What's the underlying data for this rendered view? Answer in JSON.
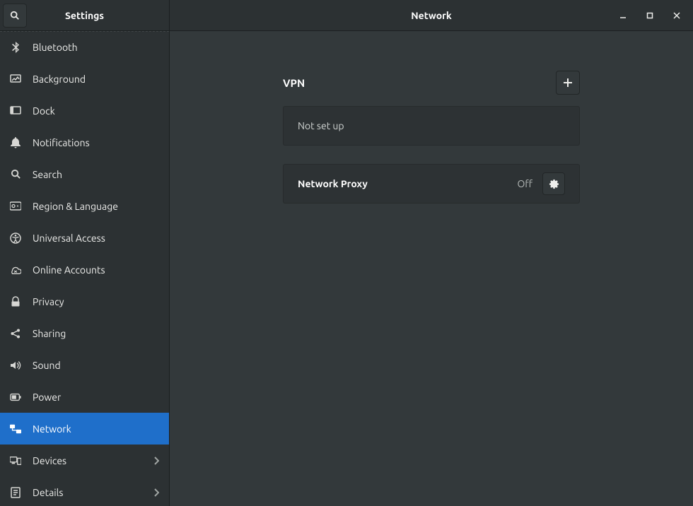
{
  "header": {
    "sidebar_title": "Settings",
    "main_title": "Network"
  },
  "sidebar": {
    "items": [
      {
        "icon": "bluetooth",
        "label": "Bluetooth",
        "active": false,
        "chevron": false
      },
      {
        "icon": "background",
        "label": "Background",
        "active": false,
        "chevron": false
      },
      {
        "icon": "dock",
        "label": "Dock",
        "active": false,
        "chevron": false
      },
      {
        "icon": "bell",
        "label": "Notifications",
        "active": false,
        "chevron": false
      },
      {
        "icon": "search",
        "label": "Search",
        "active": false,
        "chevron": false
      },
      {
        "icon": "region",
        "label": "Region & Language",
        "active": false,
        "chevron": false
      },
      {
        "icon": "access",
        "label": "Universal Access",
        "active": false,
        "chevron": false
      },
      {
        "icon": "online",
        "label": "Online Accounts",
        "active": false,
        "chevron": false
      },
      {
        "icon": "privacy",
        "label": "Privacy",
        "active": false,
        "chevron": false
      },
      {
        "icon": "sharing",
        "label": "Sharing",
        "active": false,
        "chevron": false
      },
      {
        "icon": "sound",
        "label": "Sound",
        "active": false,
        "chevron": false
      },
      {
        "icon": "power",
        "label": "Power",
        "active": false,
        "chevron": false
      },
      {
        "icon": "network",
        "label": "Network",
        "active": true,
        "chevron": false
      },
      {
        "icon": "devices",
        "label": "Devices",
        "active": false,
        "chevron": true
      },
      {
        "icon": "details",
        "label": "Details",
        "active": false,
        "chevron": true
      }
    ]
  },
  "vpn": {
    "title": "VPN",
    "empty_text": "Not set up"
  },
  "proxy": {
    "title": "Network Proxy",
    "status": "Off"
  }
}
